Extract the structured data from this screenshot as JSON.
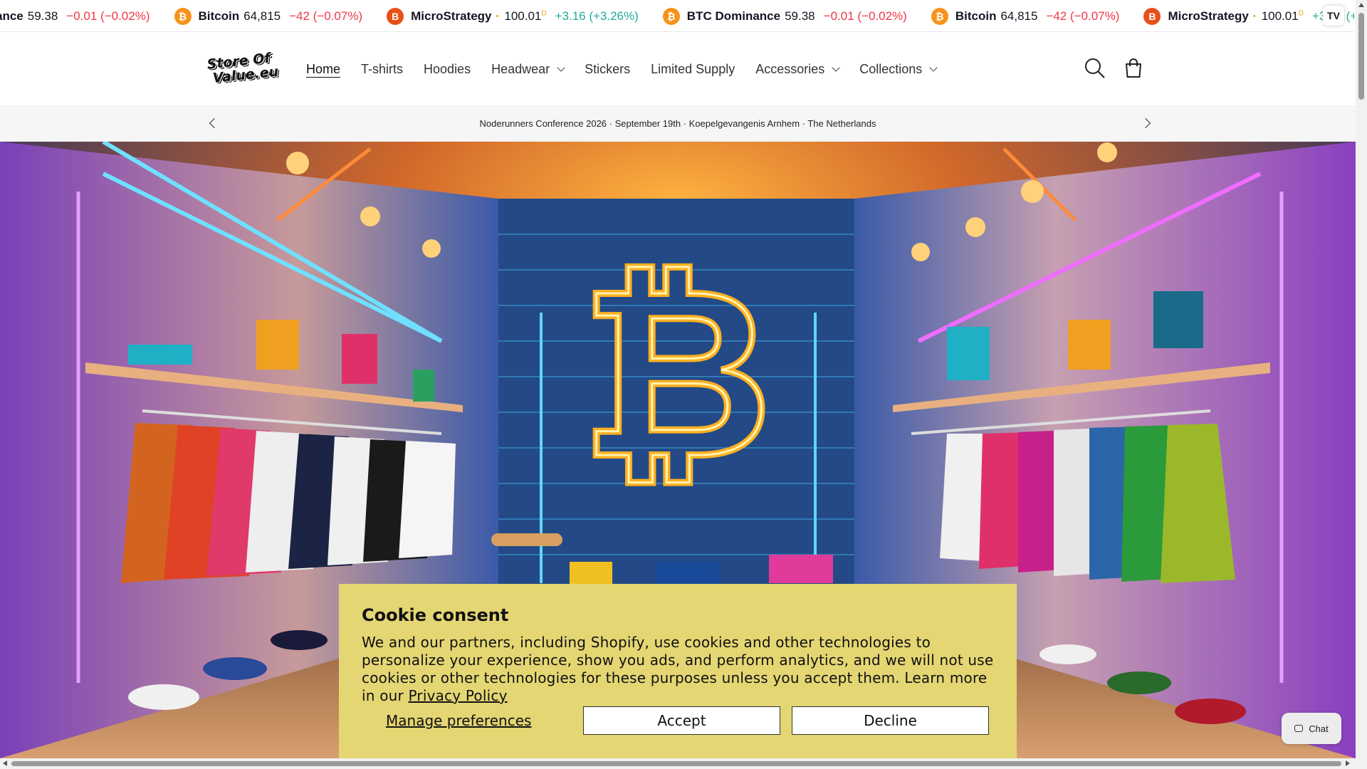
{
  "ticker": {
    "items": [
      {
        "name": "ance",
        "price": "59.38",
        "change": "−0.01 (−0.02%)",
        "trend": "neg",
        "coin": false
      },
      {
        "name": "Bitcoin",
        "price": "64,815",
        "change": "−42 (−0.07%)",
        "trend": "neg",
        "coin": true,
        "coin_symbol": "₿"
      },
      {
        "name": "MicroStrategy",
        "price": "100.01",
        "price_sup": "D",
        "change": "+3.16 (+3.26%)",
        "trend": "pos",
        "coin": true,
        "coin_symbol": "B"
      },
      {
        "name": "BTC Dominance",
        "price": "59.38",
        "change": "−0.01 (−0.02%)",
        "trend": "neg",
        "coin": true,
        "coin_symbol": "₿"
      },
      {
        "name": "Bitcoin",
        "price": "64,815",
        "change": "−42 (−0.07%)",
        "trend": "neg",
        "coin": true,
        "coin_symbol": "₿"
      },
      {
        "name": "MicroStrategy",
        "price": "100.01",
        "price_sup": "D",
        "change": "+3.16 (+3.26%)",
        "trend": "pos",
        "coin": true,
        "coin_symbol": "B"
      }
    ],
    "logo": "TV",
    "colors": {
      "negative": "#f23645",
      "positive": "#22ab94",
      "coin": "#f7931a"
    }
  },
  "header": {
    "logo_line1": "Store Of",
    "logo_line2": "Value.eu",
    "nav": [
      {
        "label": "Home",
        "active": true,
        "dropdown": false
      },
      {
        "label": "T-shirts",
        "active": false,
        "dropdown": false
      },
      {
        "label": "Hoodies",
        "active": false,
        "dropdown": false
      },
      {
        "label": "Headwear",
        "active": false,
        "dropdown": true
      },
      {
        "label": "Stickers",
        "active": false,
        "dropdown": false
      },
      {
        "label": "Limited Supply",
        "active": false,
        "dropdown": false
      },
      {
        "label": "Accessories",
        "active": false,
        "dropdown": true
      },
      {
        "label": "Collections",
        "active": false,
        "dropdown": true
      }
    ],
    "icons": {
      "search": "search-icon",
      "cart": "cart-icon"
    }
  },
  "announcement": {
    "text": "Noderunners Conference 2026 · September 19th · Koepelgevangenis Arnhem · The Netherlands"
  },
  "hero": {
    "image": "neon bitcoin store interior",
    "accent_orange": "#ff9a1f",
    "accent_blue": "#35c8ff",
    "accent_pink": "#e35cff"
  },
  "cookie": {
    "title": "Cookie consent",
    "body": "We and our partners, including Shopify, use cookies and other technologies to personalize your experience, show you ads, and perform analytics, and we will not use cookies or other technologies for these purposes unless you accept them. Learn more in our",
    "link": "Privacy Policy",
    "manage": "Manage preferences",
    "accept": "Accept",
    "decline": "Decline",
    "background": "#e4d673"
  },
  "chat": {
    "label": "Chat"
  }
}
